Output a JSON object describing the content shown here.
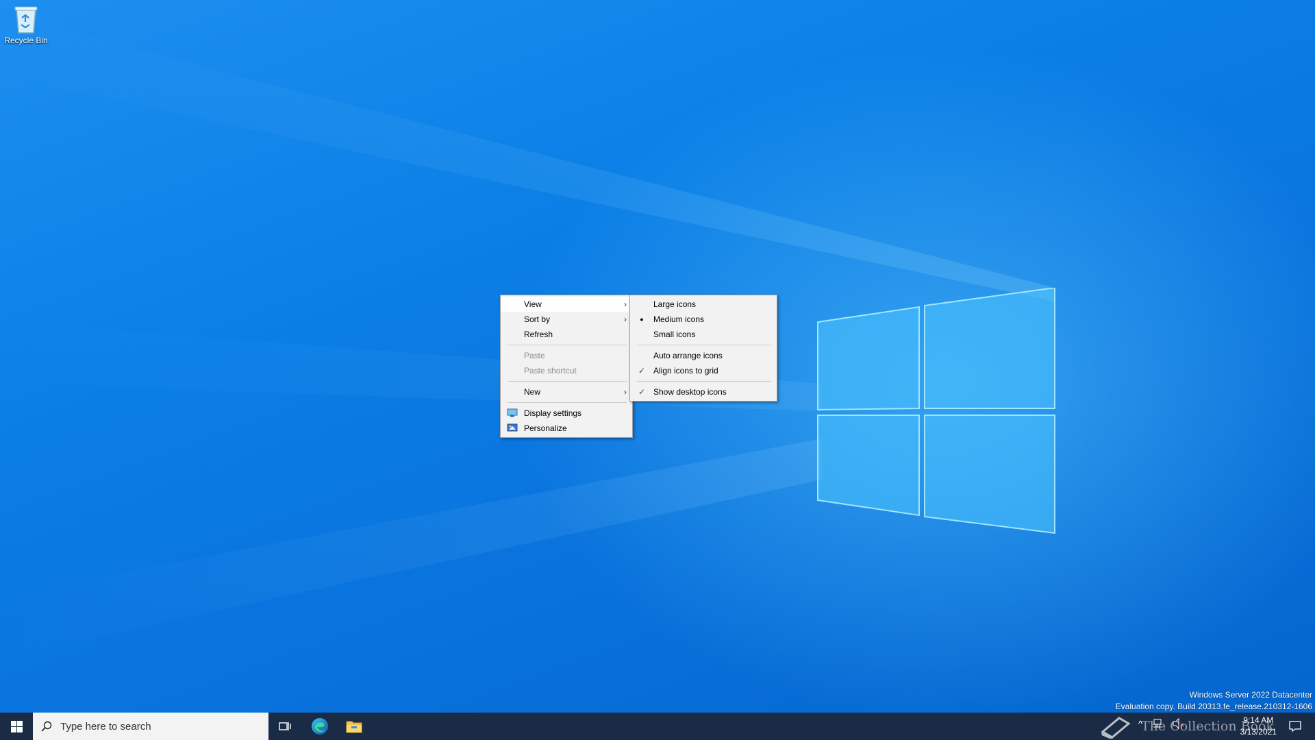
{
  "desktop": {
    "icons": [
      {
        "label": "Recycle Bin",
        "icon": "recycle-bin-icon"
      }
    ],
    "watermark": {
      "line1": "Windows Server 2022 Datacenter",
      "line2": "Evaluation copy. Build 20313.fe_release.210312-1606"
    },
    "overlay_text": "The Collection Book"
  },
  "context_menu": {
    "items": [
      {
        "label": "View",
        "submenu": true,
        "state": "highlighted"
      },
      {
        "label": "Sort by",
        "submenu": true
      },
      {
        "label": "Refresh"
      },
      {
        "label": "Paste",
        "disabled": true
      },
      {
        "label": "Paste shortcut",
        "disabled": true
      },
      {
        "label": "New",
        "submenu": true
      },
      {
        "label": "Display settings",
        "icon": "display-settings-icon"
      },
      {
        "label": "Personalize",
        "icon": "personalize-icon"
      }
    ],
    "arrow": "›"
  },
  "view_submenu": {
    "items": [
      {
        "label": "Large icons"
      },
      {
        "label": "Medium icons",
        "mark": "●"
      },
      {
        "label": "Small icons"
      },
      {
        "label": "Auto arrange icons"
      },
      {
        "label": "Align icons to grid",
        "mark": "✓"
      },
      {
        "label": "Show desktop icons",
        "mark": "✓"
      }
    ]
  },
  "taskbar": {
    "search_placeholder": "Type here to search",
    "pinned": [
      "start-icon",
      "task-view-icon",
      "edge-icon",
      "file-explorer-icon"
    ],
    "clock": {
      "time": "9:14 AM",
      "date": "3/13/2021"
    }
  },
  "colors": {
    "taskbar": "#1a2b45",
    "menu_bg": "#f2f2f2",
    "desktop_blue": "#0a74de"
  }
}
